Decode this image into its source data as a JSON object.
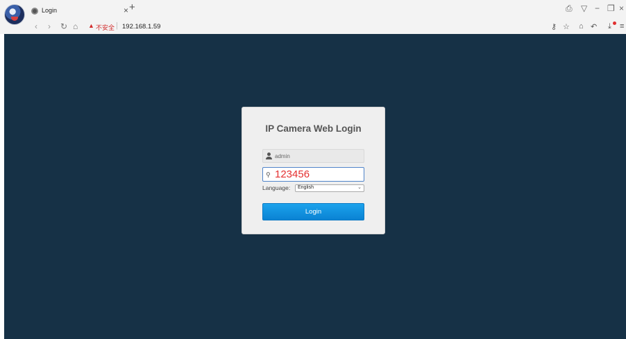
{
  "browser": {
    "tab_title": "Login",
    "tab_close": "×",
    "new_tab": "+",
    "security_warning_icon": "warning-icon",
    "security_text": "不安全",
    "url_separator": "|",
    "url": "192.168.1.59"
  },
  "login": {
    "title": "IP Camera Web Login",
    "username_value": "admin",
    "password_value": "123456",
    "language_label": "Language:",
    "language_selected": "English",
    "login_button": "Login"
  },
  "colors": {
    "page_background": "#163146",
    "card_background": "#efefef",
    "button": "#0a82d3",
    "password_text": "#e42f2f",
    "insecure_warning": "#d22c2c"
  }
}
